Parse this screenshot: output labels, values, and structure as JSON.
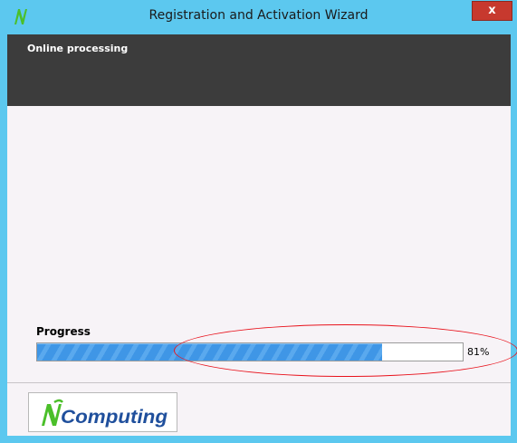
{
  "window": {
    "title": "Registration and Activation Wizard",
    "close_label": "x"
  },
  "header": {
    "title": "Online processing"
  },
  "progress": {
    "label": "Progress",
    "percent_text": "81%",
    "fraction": 0.81
  },
  "footer": {
    "logo_text": "NComputing"
  },
  "colors": {
    "titlebar": "#5cc8ef",
    "header_band": "#3c3c3c",
    "progress_fill": "#3f96e6",
    "annotation": "#e8121c",
    "logo_green": "#4bbf2a",
    "logo_blue": "#1f4f9c"
  }
}
